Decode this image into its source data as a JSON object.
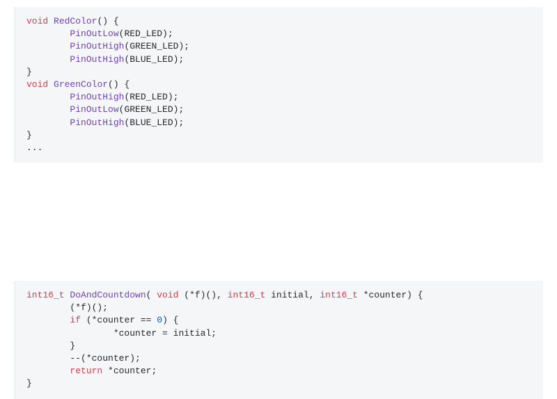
{
  "code1": {
    "kw_void1": "void",
    "fn_red": "RedColor",
    "paren_empty": "()",
    "brace_open": "{",
    "call_low": "PinOutLow",
    "call_high": "PinOutHigh",
    "arg_red": "(RED_LED);",
    "arg_green": "(GREEN_LED);",
    "arg_blue": "(BLUE_LED);",
    "brace_close": "}",
    "kw_void2": "void",
    "fn_green": "GreenColor",
    "ellipsis": "..."
  },
  "code2": {
    "t_int16": "int16_t",
    "fn_do": "DoAndCountdown",
    "sig_open": "( ",
    "kw_void": "void",
    "sig_fptr": " (*f)(), ",
    "t_int16b": "int16_t",
    "sig_initial": " initial, ",
    "t_int16c": "int16_t",
    "sig_counter": " *counter) {",
    "call_f": "(*f)();",
    "kw_if": "if",
    "cond_open": " (*counter == ",
    "zero": "0",
    "cond_close": ") {",
    "assign": "*counter = initial;",
    "brace_close_inner": "}",
    "decr": "--(*counter);",
    "kw_return": "return",
    "ret_expr": " *counter;",
    "brace_close_outer": "}"
  }
}
